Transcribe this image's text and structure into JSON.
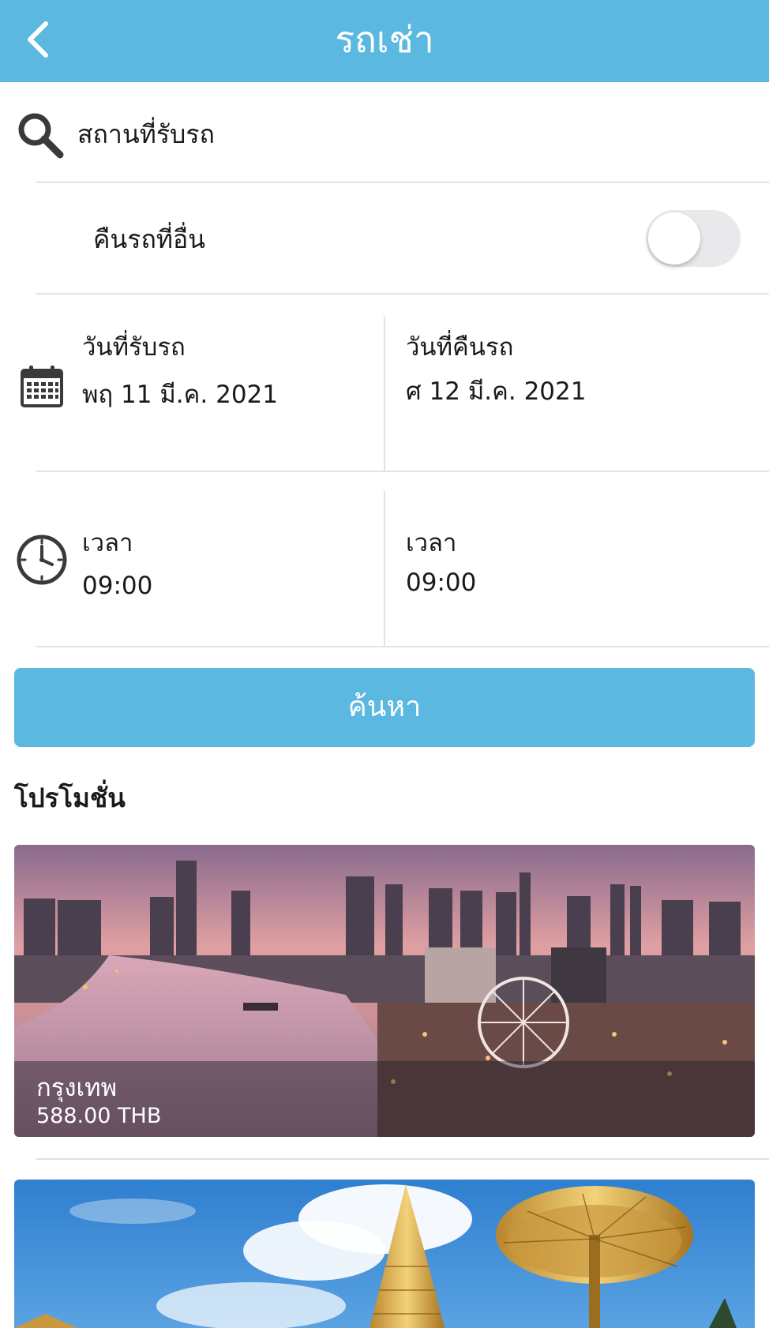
{
  "header": {
    "title": "รถเช่า",
    "back_icon": "chevron-left-icon"
  },
  "pickup_location": {
    "icon": "search-icon",
    "placeholder": "สถานที่รับรถ"
  },
  "return_elsewhere": {
    "label": "คืนรถที่อื่น",
    "enabled": false
  },
  "dates": {
    "icon": "calendar-icon",
    "pickup_label": "วันที่รับรถ",
    "pickup_value": "พฤ 11 มี.ค. 2021",
    "return_label": "วันที่คืนรถ",
    "return_value": "ศ 12 มี.ค. 2021"
  },
  "times": {
    "icon": "clock-icon",
    "pickup_label": "เวลา",
    "pickup_value": "09:00",
    "return_label": "เวลา",
    "return_value": "09:00"
  },
  "search_button": {
    "label": "ค้นหา"
  },
  "promotions": {
    "title": "โปรโมชั่น",
    "items": [
      {
        "city": "กรุงเทพ",
        "price": "588.00 THB"
      },
      {
        "city": "",
        "price": ""
      }
    ]
  },
  "colors": {
    "accent": "#5bb8e0",
    "divider": "#e3e3e3",
    "toggle_off": "#e9e9eb"
  }
}
